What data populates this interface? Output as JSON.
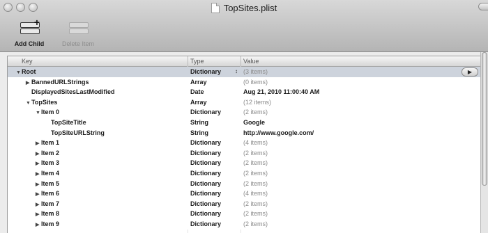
{
  "window": {
    "title": "TopSites.plist"
  },
  "toolbar": {
    "add_child_label": "Add Child",
    "delete_item_label": "Delete Item"
  },
  "table": {
    "headers": [
      "Key",
      "Type",
      "Value"
    ],
    "rows": [
      {
        "key": "Root",
        "indent": 0,
        "disclosure": "open",
        "type": "Dictionary",
        "value": "(3 items)",
        "muted": true,
        "selected": true,
        "stepper": true
      },
      {
        "key": "BannedURLStrings",
        "indent": 1,
        "disclosure": "closed",
        "type": "Array",
        "value": "(0 items)",
        "muted": true
      },
      {
        "key": "DisplayedSitesLastModified",
        "indent": 1,
        "disclosure": "none",
        "type": "Date",
        "value": "Aug 21, 2010 11:00:40 AM",
        "muted": false
      },
      {
        "key": "TopSites",
        "indent": 1,
        "disclosure": "open",
        "type": "Array",
        "value": "(12 items)",
        "muted": true
      },
      {
        "key": "Item 0",
        "indent": 2,
        "disclosure": "open",
        "type": "Dictionary",
        "value": "(2 items)",
        "muted": true
      },
      {
        "key": "TopSiteTitle",
        "indent": 3,
        "disclosure": "none",
        "type": "String",
        "value": "Google",
        "muted": false
      },
      {
        "key": "TopSiteURLString",
        "indent": 3,
        "disclosure": "none",
        "type": "String",
        "value": "http://www.google.com/",
        "muted": false
      },
      {
        "key": "Item 1",
        "indent": 2,
        "disclosure": "closed",
        "type": "Dictionary",
        "value": "(4 items)",
        "muted": true
      },
      {
        "key": "Item 2",
        "indent": 2,
        "disclosure": "closed",
        "type": "Dictionary",
        "value": "(2 items)",
        "muted": true
      },
      {
        "key": "Item 3",
        "indent": 2,
        "disclosure": "closed",
        "type": "Dictionary",
        "value": "(2 items)",
        "muted": true
      },
      {
        "key": "Item 4",
        "indent": 2,
        "disclosure": "closed",
        "type": "Dictionary",
        "value": "(2 items)",
        "muted": true
      },
      {
        "key": "Item 5",
        "indent": 2,
        "disclosure": "closed",
        "type": "Dictionary",
        "value": "(2 items)",
        "muted": true
      },
      {
        "key": "Item 6",
        "indent": 2,
        "disclosure": "closed",
        "type": "Dictionary",
        "value": "(4 items)",
        "muted": true
      },
      {
        "key": "Item 7",
        "indent": 2,
        "disclosure": "closed",
        "type": "Dictionary",
        "value": "(2 items)",
        "muted": true
      },
      {
        "key": "Item 8",
        "indent": 2,
        "disclosure": "closed",
        "type": "Dictionary",
        "value": "(2 items)",
        "muted": true
      },
      {
        "key": "Item 9",
        "indent": 2,
        "disclosure": "closed",
        "type": "Dictionary",
        "value": "(2 items)",
        "muted": true
      }
    ]
  },
  "colors": {
    "selected_row": "#cdd3dc",
    "muted_value": "#8a8a8a"
  }
}
